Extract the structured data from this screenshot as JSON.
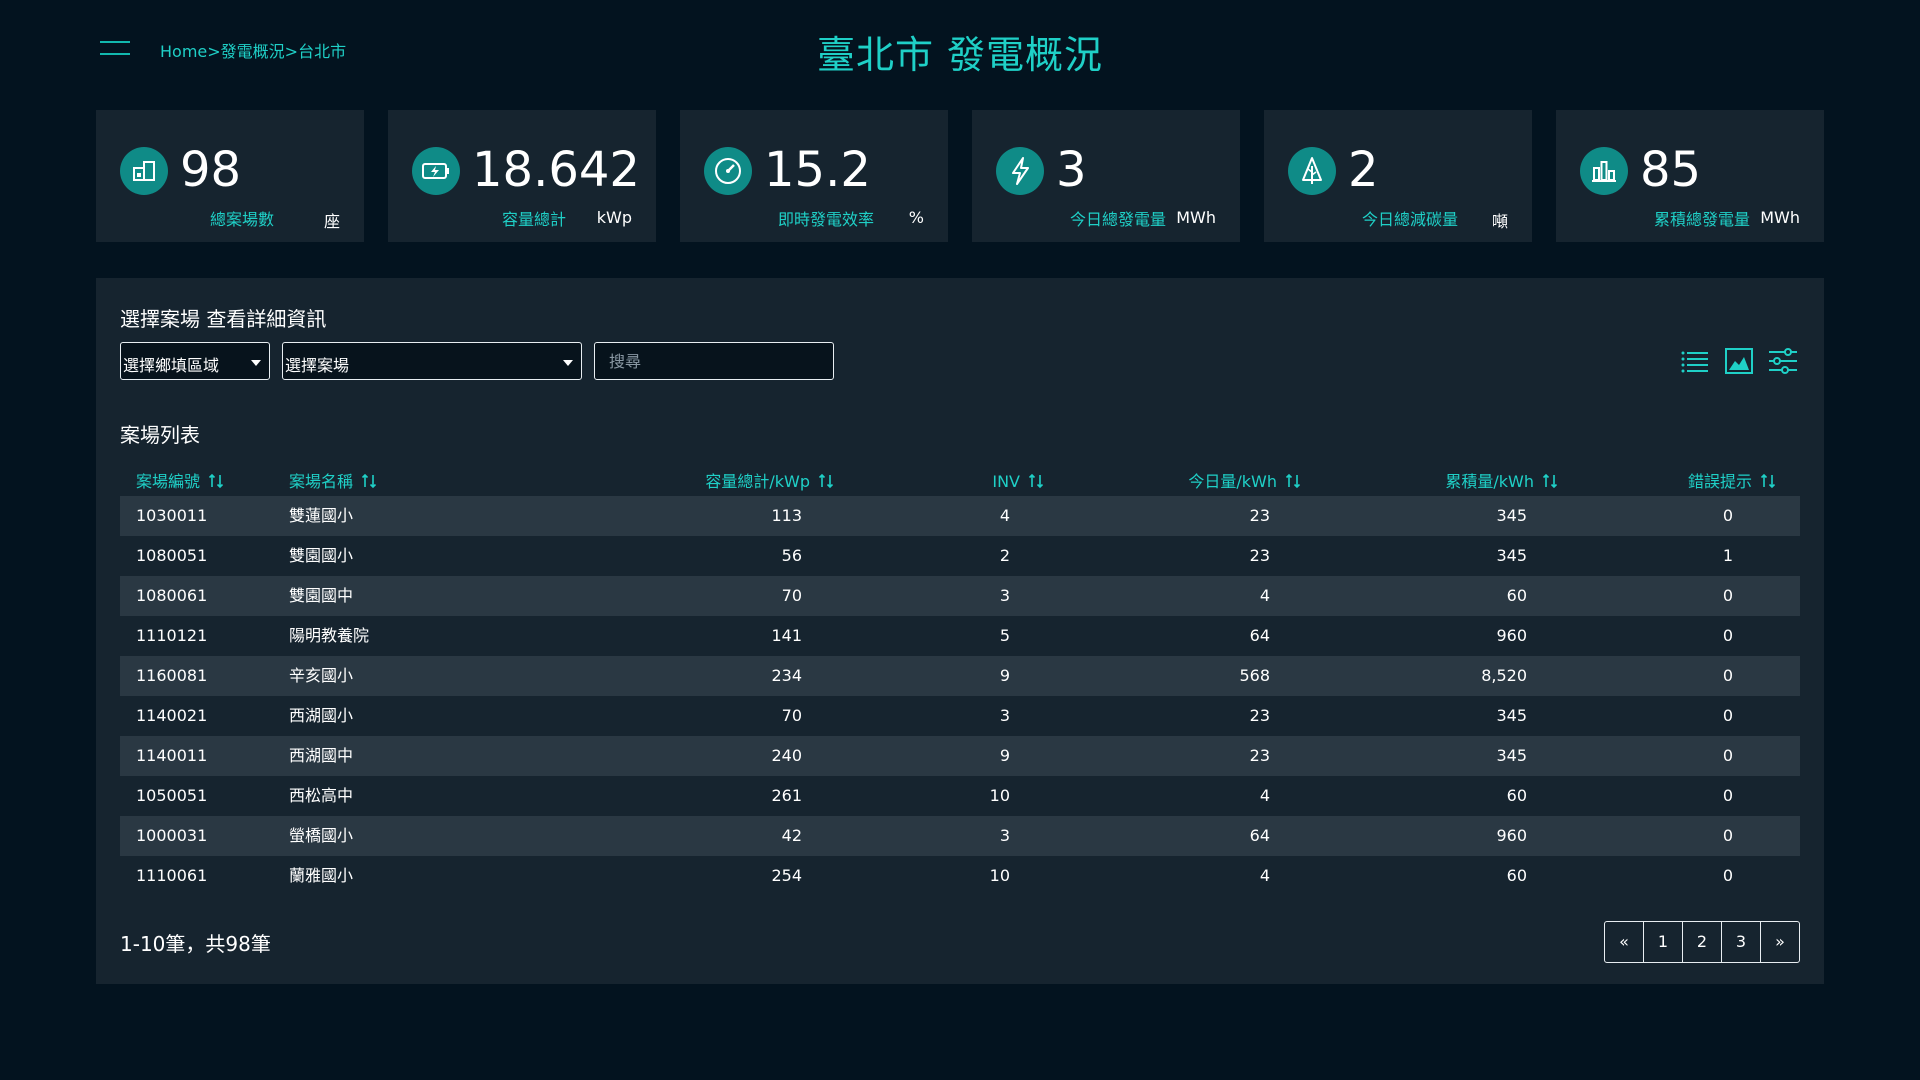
{
  "breadcrumb": "Home>發電概況>台北市",
  "page_title": "臺北市 發電概況",
  "kpis": [
    {
      "icon": "building-icon",
      "value": "98",
      "label": "總案場數",
      "unit": "座"
    },
    {
      "icon": "battery-icon",
      "value": "18.642",
      "label": "容量總計",
      "unit": "kWp"
    },
    {
      "icon": "gauge-icon",
      "value": "15.2",
      "label": "即時發電效率",
      "unit": "%"
    },
    {
      "icon": "lightning-icon",
      "value": "3",
      "label": "今日總發電量",
      "unit": "MWh"
    },
    {
      "icon": "tree-icon",
      "value": "2",
      "label": "今日總減碳量",
      "unit": "噸"
    },
    {
      "icon": "bar-chart-icon",
      "value": "85",
      "label": "累積總發電量",
      "unit": "MWh"
    }
  ],
  "filter": {
    "section_title": "選擇案場 查看詳細資訊",
    "district_select": "選擇鄉填區域",
    "site_select": "選擇案場",
    "search_placeholder": "搜尋"
  },
  "view_icons": [
    "list-view-icon",
    "chart-view-icon",
    "filter-settings-icon"
  ],
  "table": {
    "title": "案場列表",
    "columns": [
      "案場編號",
      "案場名稱",
      "容量總計/kWp",
      "INV",
      "今日量/kWh",
      "累積量/kWh",
      "錯誤提示"
    ],
    "rows": [
      [
        "1030011",
        "雙蓮國小",
        "113",
        "4",
        "23",
        "345",
        "0"
      ],
      [
        "1080051",
        "雙園國小",
        "56",
        "2",
        "23",
        "345",
        "1"
      ],
      [
        "1080061",
        "雙園國中",
        "70",
        "3",
        "4",
        "60",
        "0"
      ],
      [
        "1110121",
        "陽明教養院",
        "141",
        "5",
        "64",
        "960",
        "0"
      ],
      [
        "1160081",
        "辛亥國小",
        "234",
        "9",
        "568",
        "8,520",
        "0"
      ],
      [
        "1140021",
        "西湖國小",
        "70",
        "3",
        "23",
        "345",
        "0"
      ],
      [
        "1140011",
        "西湖國中",
        "240",
        "9",
        "23",
        "345",
        "0"
      ],
      [
        "1050051",
        "西松高中",
        "261",
        "10",
        "4",
        "60",
        "0"
      ],
      [
        "1000031",
        "螢橋國小",
        "42",
        "3",
        "64",
        "960",
        "0"
      ],
      [
        "1110061",
        "蘭雅國小",
        "254",
        "10",
        "4",
        "60",
        "0"
      ]
    ]
  },
  "pagination": {
    "info": "1-10筆，共98筆",
    "prev": "«",
    "pages": [
      "1",
      "2",
      "3"
    ],
    "next": "»"
  },
  "colors": {
    "accent": "#1fd0c7",
    "icon_bg": "#0f8b87",
    "card_bg": "#16242f",
    "page_bg": "#03131f"
  }
}
